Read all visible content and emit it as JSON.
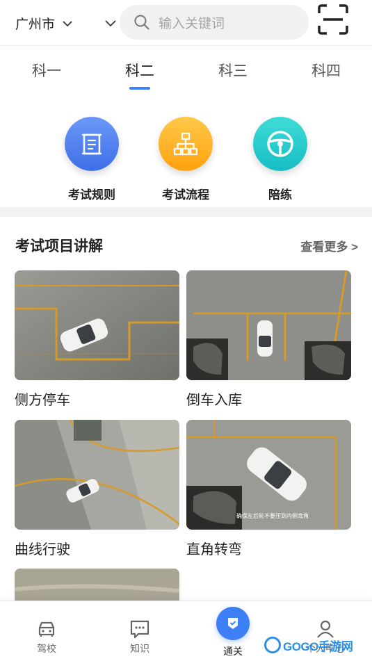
{
  "header": {
    "city": "广州市",
    "search_placeholder": "输入关键词"
  },
  "tabs": [
    {
      "label": "科一",
      "active": false
    },
    {
      "label": "科二",
      "active": true
    },
    {
      "label": "科三",
      "active": false
    },
    {
      "label": "科四",
      "active": false
    }
  ],
  "entries": [
    {
      "label": "考试规则",
      "icon": "scroll-icon",
      "color": "#4a7cf0"
    },
    {
      "label": "考试流程",
      "icon": "flowchart-icon",
      "color": "#ffae1a"
    },
    {
      "label": "陪练",
      "icon": "steering-wheel-icon",
      "color": "#1ec7c8"
    }
  ],
  "section": {
    "title": "考试项目讲解",
    "more": "查看更多 >"
  },
  "cards": [
    {
      "caption": "侧方停车"
    },
    {
      "caption": "倒车入库"
    },
    {
      "caption": "曲线行驶"
    },
    {
      "caption": "直角转弯",
      "overlay_text": "确保左后轮不要压到内侧弯角"
    }
  ],
  "bottom_nav": [
    {
      "label": "驾校",
      "icon": "car-icon",
      "active": false
    },
    {
      "label": "知识",
      "icon": "chat-icon",
      "active": false
    },
    {
      "label": "通关",
      "icon": "check-badge-icon",
      "active": true
    },
    {
      "label": "个人中心",
      "icon": "user-icon",
      "active": false
    }
  ],
  "watermark": "GOGO手游网",
  "colors": {
    "accent": "#3d7ff5"
  }
}
